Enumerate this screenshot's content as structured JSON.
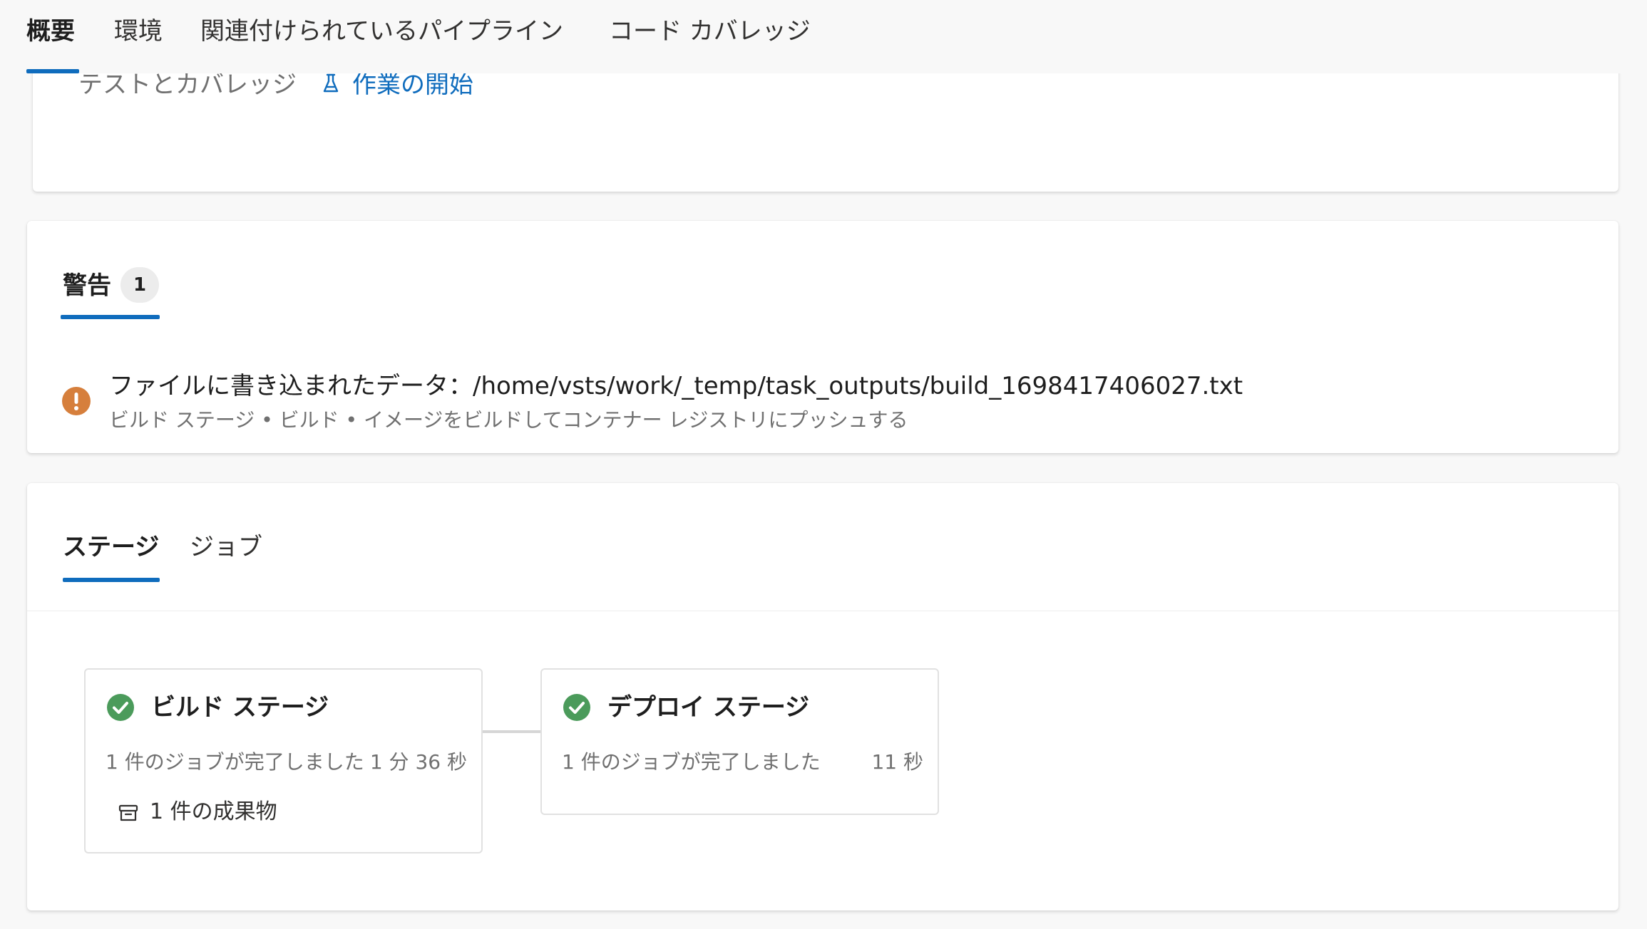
{
  "nav": {
    "tabs": [
      {
        "label": "概要",
        "active": true
      },
      {
        "label": "環境",
        "active": false
      },
      {
        "label": "関連付けられているパイプライン",
        "active": false
      },
      {
        "label": "コード カバレッジ",
        "active": false
      }
    ]
  },
  "tests": {
    "label": "テストとカバレッジ",
    "link": "作業の開始",
    "icon": "flask-icon"
  },
  "warnings": {
    "title": "警告",
    "count": "1",
    "items": [
      {
        "icon": "warning-icon",
        "message": "ファイルに書き込まれたデータ：/home/vsts/work/_temp/task_outputs/build_1698417406027.txt",
        "path": "ビルド ステージ  • ビルド  • イメージをビルドしてコンテナー レジストリにプッシュする"
      }
    ]
  },
  "stages": {
    "tabs": [
      {
        "label": "ステージ",
        "active": true
      },
      {
        "label": "ジョブ",
        "active": false
      }
    ],
    "items": [
      {
        "name": "ビルド ステージ",
        "jobs": "1 件のジョブが完了しました",
        "duration": "1 分 36 秒",
        "artifacts": "1 件の成果物",
        "status": "succeeded"
      },
      {
        "name": "デプロイ ステージ",
        "jobs": "1 件のジョブが完了しました",
        "duration": "11 秒",
        "status": "succeeded"
      }
    ]
  },
  "colors": {
    "accent": "#0f6cbd",
    "success": "#4b9b5b",
    "warning": "#d67f3c",
    "muted": "#707070"
  }
}
